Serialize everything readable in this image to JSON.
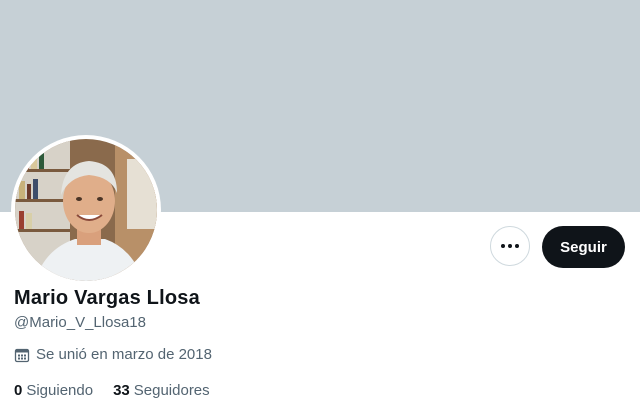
{
  "profile": {
    "name": "Mario Vargas Llosa",
    "handle": "@Mario_V_Llosa18",
    "joined": "Se unió en marzo de 2018"
  },
  "actions": {
    "follow_label": "Seguir",
    "more_icon": "more-horizontal-icon"
  },
  "stats": {
    "following_count": "0",
    "following_label": "Siguiendo",
    "followers_count": "33",
    "followers_label": "Seguidores"
  },
  "colors": {
    "banner": "#c6d0d6",
    "follow_button": "#0f1419",
    "secondary_text": "#536471"
  }
}
